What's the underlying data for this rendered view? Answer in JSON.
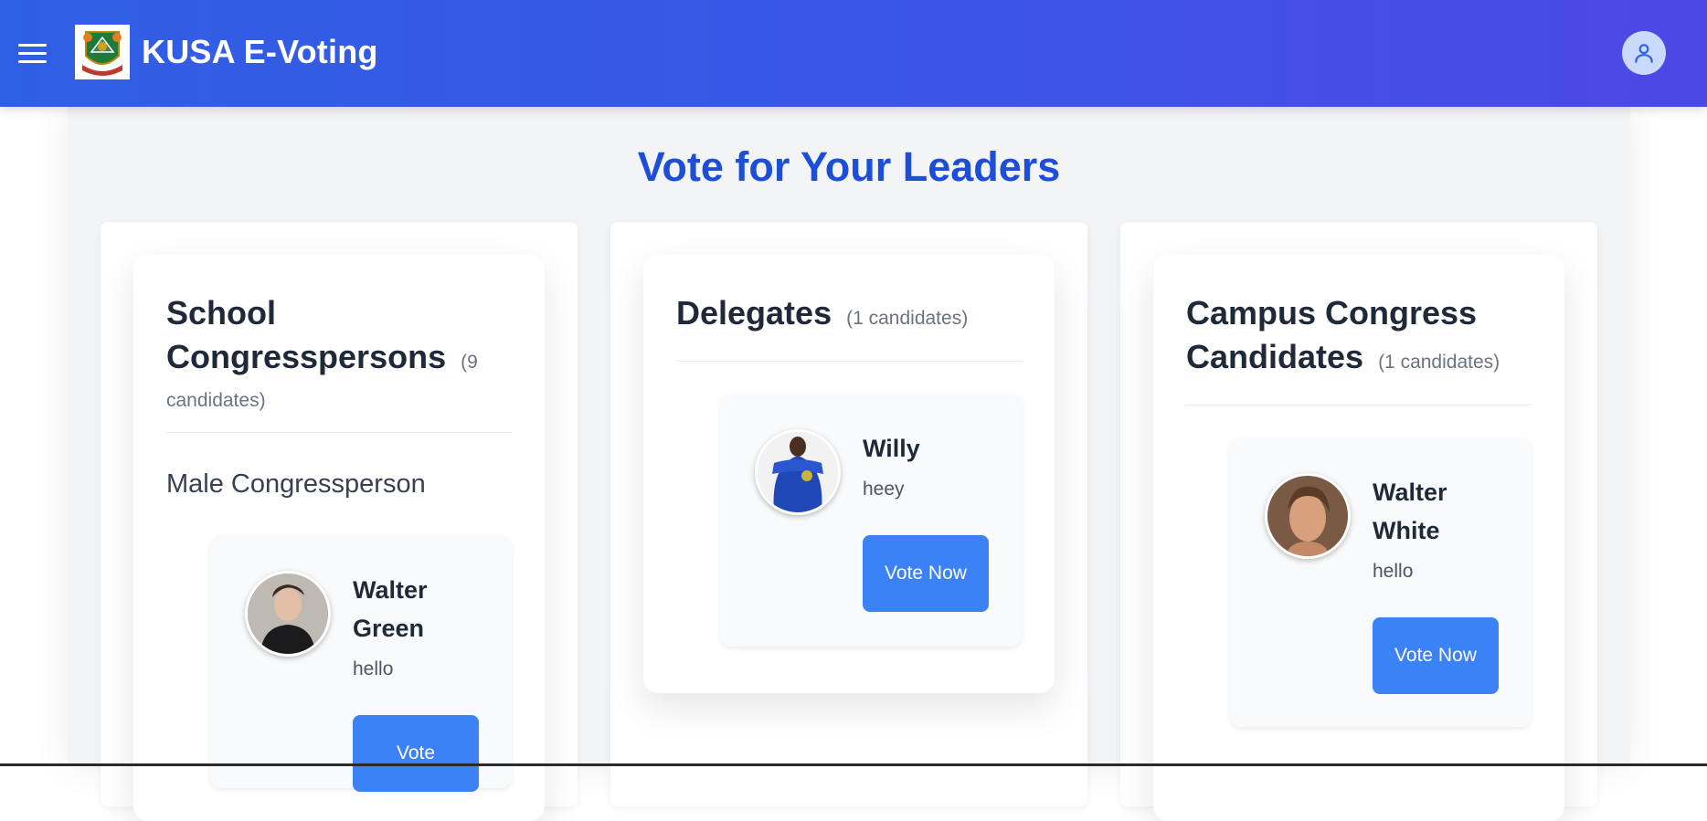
{
  "header": {
    "title": "KUSA E-Voting",
    "menu_icon": "hamburger-menu-icon",
    "user_icon": "user-icon",
    "accent": "#3b5ae6"
  },
  "main": {
    "title": "Vote for Your Leaders",
    "title_color": "#1d4ed8",
    "button_color": "#3b82f6"
  },
  "positions": [
    {
      "title_line1": "School",
      "title_line2": "Congresspersons",
      "count": "(9",
      "count_cont": "candidates)",
      "subcategory": "Male Congressperson",
      "candidates": [
        {
          "name_line1": "Walter",
          "name_line2": "Green",
          "description": "hello",
          "vote_label": "Vote"
        }
      ]
    },
    {
      "title": "Delegates",
      "count": "(1 candidates)",
      "candidates": [
        {
          "name": "Willy",
          "description": "heey",
          "vote_label": "Vote Now"
        }
      ]
    },
    {
      "title_line1": "Campus Congress",
      "title_line2": "Candidates",
      "count": "(1 candidates)",
      "candidates": [
        {
          "name_line1": "Walter",
          "name_line2": "White",
          "description": "hello",
          "vote_label": "Vote Now"
        }
      ]
    }
  ]
}
